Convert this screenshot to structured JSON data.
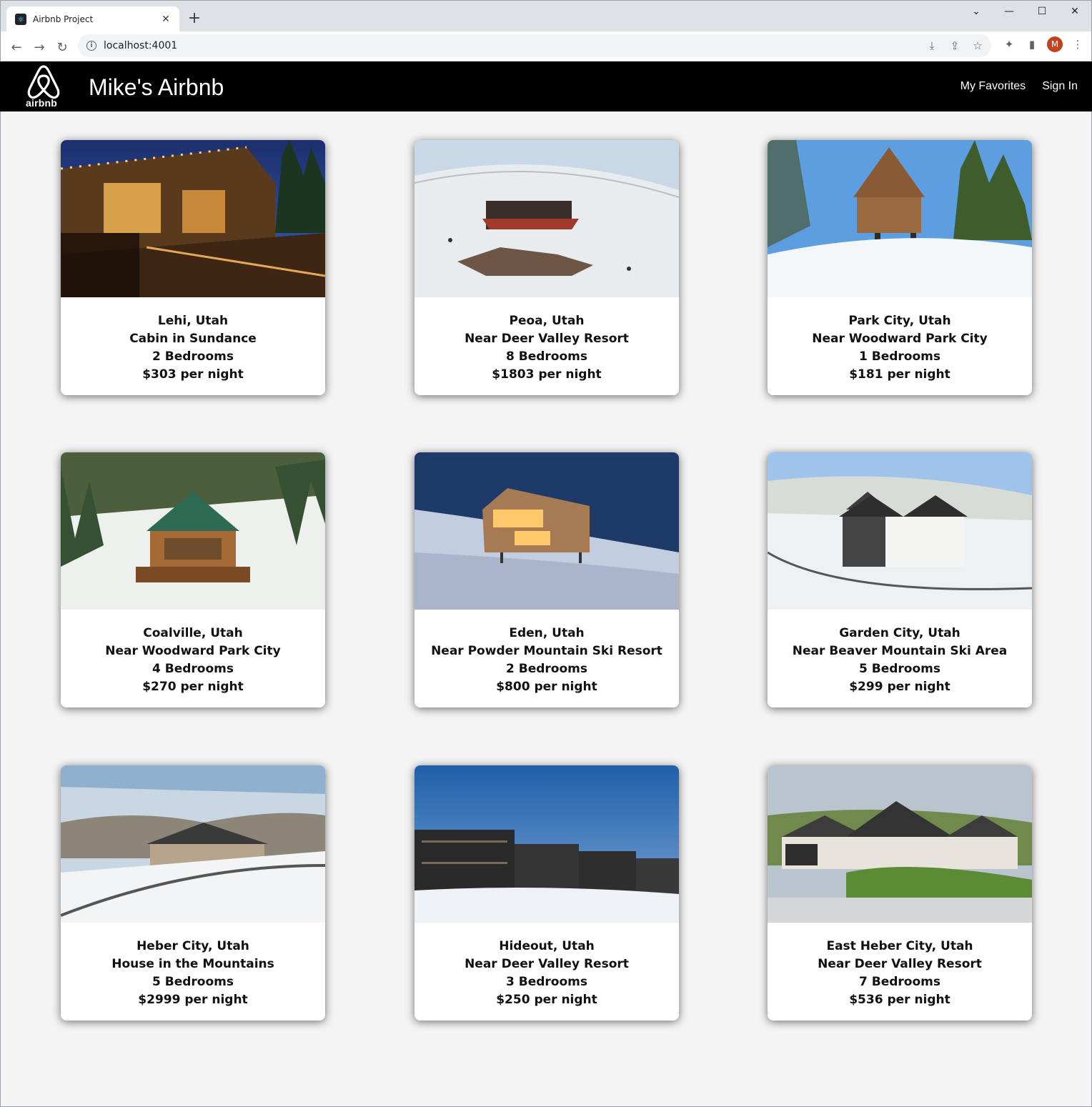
{
  "browser": {
    "tab_title": "Airbnb Project",
    "url": "localhost:4001",
    "profile_initial": "M"
  },
  "header": {
    "logo_text": "airbnb",
    "title": "Mike's Airbnb",
    "nav": [
      "My Favorites",
      "Sign In"
    ]
  },
  "listings": [
    {
      "location": "Lehi, Utah",
      "title": "Cabin in Sundance",
      "bedrooms": "2 Bedrooms",
      "price": "$303 per night"
    },
    {
      "location": "Peoa, Utah",
      "title": "Near Deer Valley Resort",
      "bedrooms": "8 Bedrooms",
      "price": "$1803 per night"
    },
    {
      "location": "Park City, Utah",
      "title": "Near Woodward Park City",
      "bedrooms": "1 Bedrooms",
      "price": "$181 per night"
    },
    {
      "location": "Coalville, Utah",
      "title": "Near Woodward Park City",
      "bedrooms": "4 Bedrooms",
      "price": "$270 per night"
    },
    {
      "location": "Eden, Utah",
      "title": "Near Powder Mountain Ski Resort",
      "bedrooms": "2 Bedrooms",
      "price": "$800 per night"
    },
    {
      "location": "Garden City, Utah",
      "title": "Near Beaver Mountain Ski Area",
      "bedrooms": "5 Bedrooms",
      "price": "$299 per night"
    },
    {
      "location": "Heber City, Utah",
      "title": "House in the Mountains",
      "bedrooms": "5 Bedrooms",
      "price": "$2999 per night"
    },
    {
      "location": "Hideout, Utah",
      "title": "Near Deer Valley Resort",
      "bedrooms": "3 Bedrooms",
      "price": "$250 per night"
    },
    {
      "location": "East Heber City, Utah",
      "title": "Near Deer Valley Resort",
      "bedrooms": "7 Bedrooms",
      "price": "$536 per night"
    }
  ]
}
